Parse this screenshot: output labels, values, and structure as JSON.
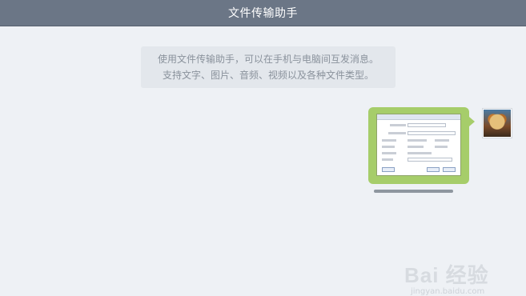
{
  "window": {
    "title": "文件传输助手"
  },
  "hint": {
    "line1": "使用文件传输助手，可以在手机与电脑间互发消息。",
    "line2": "支持文字、图片、音频、视频以及各种文件类型。"
  },
  "message": {
    "type": "image",
    "sender": "self",
    "avatar_icon": "user-avatar-icon",
    "bubble_color": "#a6cd6a"
  },
  "watermark": {
    "main": "Bai 经验",
    "sub": "jingyan.baidu.com"
  },
  "colors": {
    "titlebar": "#6b7686",
    "background": "#eef1f5",
    "hint_bg": "#e3e7ec"
  }
}
